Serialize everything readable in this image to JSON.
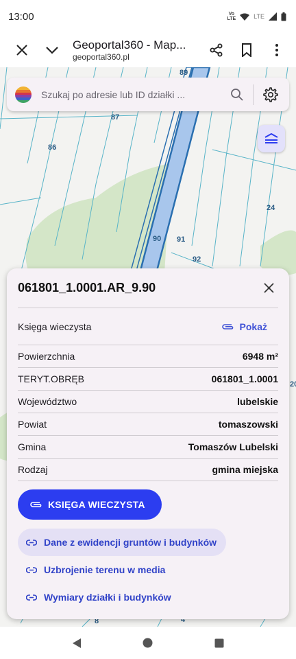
{
  "status_bar": {
    "time": "13:00",
    "volte": "Vo\nLTE",
    "lte": "LTE"
  },
  "browser": {
    "title": "Geoportal360 - Map...",
    "url": "geoportal360.pl"
  },
  "map": {
    "labels": [
      "89",
      "87",
      "86",
      "24",
      "90",
      "91",
      "92",
      "20",
      "8",
      "4"
    ]
  },
  "search": {
    "placeholder": "Szukaj po adresie lub ID działki ..."
  },
  "panel": {
    "title": "061801_1.0001.AR_9.90",
    "land_register": {
      "label": "Księga wieczysta",
      "link": "Pokaż"
    },
    "attributes": [
      {
        "label": "Powierzchnia",
        "value": "6948 m²"
      },
      {
        "label": "TERYT.OBRĘB",
        "value": "061801_1.0001"
      },
      {
        "label": "Województwo",
        "value": "lubelskie"
      },
      {
        "label": "Powiat",
        "value": "tomaszowski"
      },
      {
        "label": "Gmina",
        "value": "Tomaszów Lubelski"
      },
      {
        "label": "Rodzaj",
        "value": "gmina miejska"
      }
    ],
    "primary_button": "KSIĘGA WIECZYSTA",
    "links": [
      "Dane z ewidencji gruntów i budynków",
      "Uzbrojenie terenu w media",
      "Wymiary działki i budynków"
    ]
  },
  "colors": {
    "accent": "#2c3df0",
    "link": "#3143c8",
    "highlight_parcel": "#a8c6ec"
  }
}
